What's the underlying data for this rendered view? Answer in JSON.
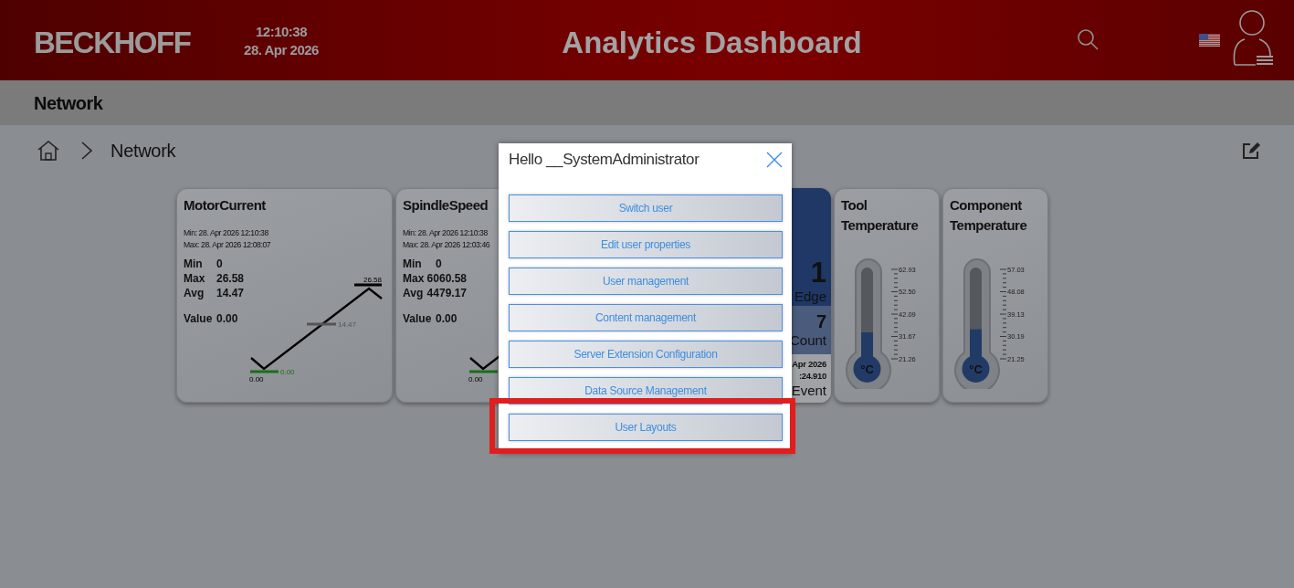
{
  "header": {
    "logo": "BECKHOFF",
    "time": "12:10:38",
    "date": "28. Apr 2026",
    "title": "Analytics Dashboard"
  },
  "page_title": "Network",
  "breadcrumb": [
    {
      "label": "Network"
    }
  ],
  "cards": [
    {
      "kind": "trend",
      "title": "MotorCurrent",
      "min_time": "Min:  28. Apr 2026 12:10:38",
      "max_time": "Max: 28. Apr 2026 12:08:07",
      "stats": [
        {
          "label": "Min",
          "value": "0"
        },
        {
          "label": "Max",
          "value": "26.58"
        },
        {
          "label": "Avg",
          "value": "14.47"
        }
      ],
      "value_label": "Value",
      "value": "0.00",
      "chart_labels": {
        "max": "26.58",
        "avg": "14.47",
        "min": "0.00",
        "start": "0.00"
      }
    },
    {
      "kind": "trend",
      "title": "SpindleSpeed",
      "min_time": "Min:  28. Apr 2026 12:10:38",
      "max_time": "Max: 28. Apr 2026 12:03:46",
      "stats": [
        {
          "label": "Min",
          "value": "0"
        },
        {
          "label": "Max",
          "value": "6060.58"
        },
        {
          "label": "Avg",
          "value": "4479.17"
        }
      ],
      "value_label": "Value",
      "value": "0.00",
      "chart_labels": {
        "start": "0.00"
      }
    },
    {
      "kind": "counter",
      "sections": [
        {
          "kind": "primary",
          "lines": [
            {
              "text": "1",
              "kind": "large"
            },
            {
              "text": "Edge",
              "kind": "medium"
            }
          ]
        },
        {
          "kind": "secondary",
          "lines": [
            {
              "text": "7",
              "kind": "big"
            },
            {
              "text": "Count",
              "kind": "medium"
            }
          ]
        },
        {
          "kind": "plain",
          "lines": [
            {
              "text": "Apr 2026",
              "kind": "small"
            },
            {
              "text": ":24.910",
              "kind": "small"
            },
            {
              "text": "Event",
              "kind": "medium"
            }
          ]
        }
      ]
    },
    {
      "kind": "thermometer",
      "title": "Tool Temperature",
      "unit": "°C",
      "level": 0.36,
      "scale": [
        "62.93",
        "52.50",
        "42.09",
        "31.67",
        "21.26"
      ]
    },
    {
      "kind": "thermometer",
      "title": "Component Temperature",
      "unit": "°C",
      "level": 0.39,
      "scale": [
        "57.03",
        "48.08",
        "39.13",
        "30.19",
        "21.25"
      ]
    }
  ],
  "user_menu": {
    "greeting": "Hello __SystemAdministrator",
    "buttons": [
      {
        "label": "Switch user",
        "highlighted": false
      },
      {
        "label": "Edit user properties",
        "highlighted": false
      },
      {
        "label": "User management",
        "highlighted": false
      },
      {
        "label": "Content management",
        "highlighted": false
      },
      {
        "label": "Server Extension Configuration",
        "highlighted": false
      },
      {
        "label": "Data Source Management",
        "highlighted": false
      },
      {
        "label": "User Layouts",
        "highlighted": true
      }
    ]
  }
}
